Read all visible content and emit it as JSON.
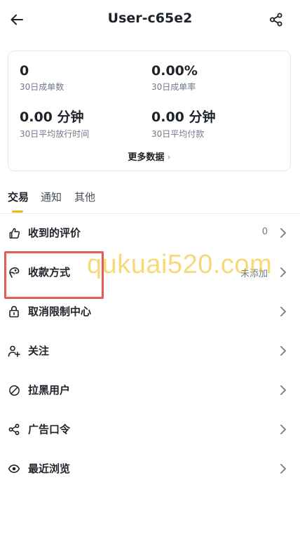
{
  "header": {
    "title": "User-c65e2",
    "back_icon": "arrow-left-icon",
    "share_icon": "share-icon"
  },
  "stats": {
    "items": [
      {
        "value": "0",
        "label": "30日成单数"
      },
      {
        "value": "0.00%",
        "label": "30日成单率"
      },
      {
        "value": "0.00 分钟",
        "label": "30日平均放行时间"
      },
      {
        "value": "0.00 分钟",
        "label": "30日平均付款"
      }
    ],
    "more_label": "更多数据"
  },
  "tabs": [
    {
      "label": "交易",
      "active": true
    },
    {
      "label": "通知",
      "active": false
    },
    {
      "label": "其他",
      "active": false
    }
  ],
  "menu": [
    {
      "label": "收到的评价",
      "value": "0",
      "icon": "thumbs-up-icon"
    },
    {
      "label": "收款方式",
      "value": "未添加",
      "icon": "payment-method-icon"
    },
    {
      "label": "取消限制中心",
      "value": "",
      "icon": "lock-icon"
    },
    {
      "label": "关注",
      "value": "",
      "icon": "user-add-icon"
    },
    {
      "label": "拉黑用户",
      "value": "",
      "icon": "block-icon"
    },
    {
      "label": "广告口令",
      "value": "",
      "icon": "share-nodes-icon"
    },
    {
      "label": "最近浏览",
      "value": "",
      "icon": "eye-icon"
    }
  ],
  "overlay": {
    "watermark": "qukuai520.com",
    "highlight_color": "#e55a5a"
  },
  "colors": {
    "accent": "#f0b90b",
    "text_primary": "#1e2329",
    "text_secondary": "#707a8a",
    "border": "#e6e8ea"
  }
}
